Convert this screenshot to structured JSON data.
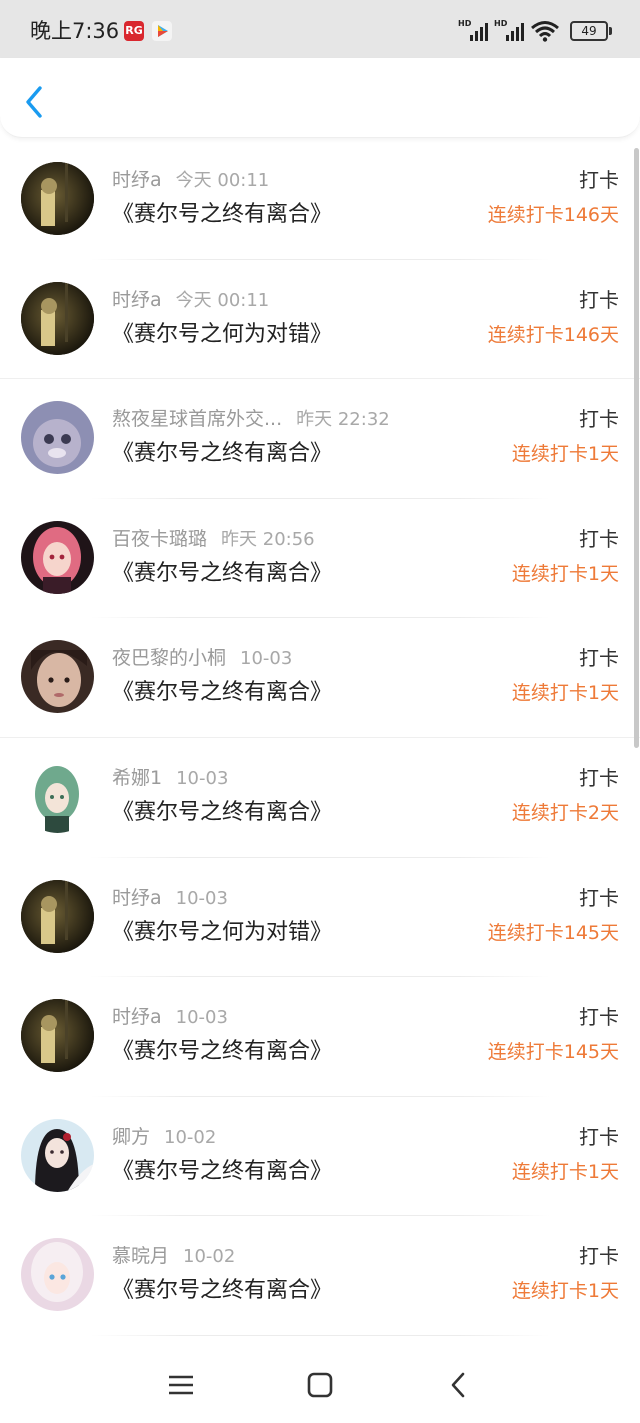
{
  "status_bar": {
    "time": "晚上7:36",
    "app_badge": "RG",
    "signal1_label": "HD",
    "signal2_label": "HD",
    "battery": "49"
  },
  "colors": {
    "accent_blue": "#1a9bf0",
    "streak_orange": "#ee7a38"
  },
  "list": {
    "items": [
      {
        "name": "时纾a",
        "time": "今天 00:11",
        "title": "《赛尔号之终有离合》",
        "tag": "打卡",
        "streak": "连续打卡146天",
        "avatar": "dark-room"
      },
      {
        "name": "时纾a",
        "time": "今天 00:11",
        "title": "《赛尔号之何为对错》",
        "tag": "打卡",
        "streak": "连续打卡146天",
        "avatar": "dark-room"
      },
      {
        "name": "熬夜星球首席外交...",
        "time": "昨天 22:32",
        "title": "《赛尔号之终有离合》",
        "tag": "打卡",
        "streak": "连续打卡1天",
        "avatar": "blue-plush"
      },
      {
        "name": "百夜卡璐璐",
        "time": "昨天 20:56",
        "title": "《赛尔号之终有离合》",
        "tag": "打卡",
        "streak": "连续打卡1天",
        "avatar": "pink-anime"
      },
      {
        "name": "夜巴黎的小桐",
        "time": "10-03",
        "title": "《赛尔号之终有离合》",
        "tag": "打卡",
        "streak": "连续打卡1天",
        "avatar": "face-photo"
      },
      {
        "name": "希娜1",
        "time": "10-03",
        "title": "《赛尔号之终有离合》",
        "tag": "打卡",
        "streak": "连续打卡2天",
        "avatar": "green-elf"
      },
      {
        "name": "时纾a",
        "time": "10-03",
        "title": "《赛尔号之何为对错》",
        "tag": "打卡",
        "streak": "连续打卡145天",
        "avatar": "dark-room"
      },
      {
        "name": "时纾a",
        "time": "10-03",
        "title": "《赛尔号之终有离合》",
        "tag": "打卡",
        "streak": "连续打卡145天",
        "avatar": "dark-room"
      },
      {
        "name": "卿方",
        "time": "10-02",
        "title": "《赛尔号之终有离合》",
        "tag": "打卡",
        "streak": "连续打卡1天",
        "avatar": "dark-hair-girl"
      },
      {
        "name": "慕晥月",
        "time": "10-02",
        "title": "《赛尔号之终有离合》",
        "tag": "打卡",
        "streak": "连续打卡1天",
        "avatar": "white-hair-girl"
      }
    ]
  }
}
